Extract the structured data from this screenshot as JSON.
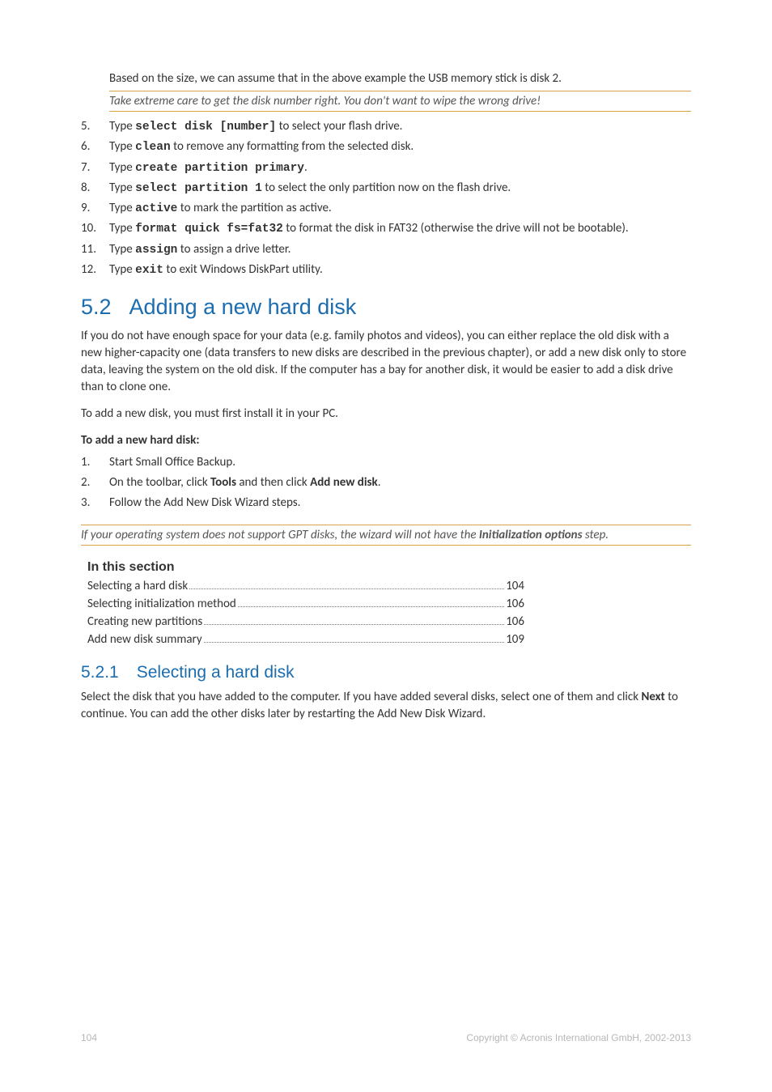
{
  "intro_line": "Based on the size, we can assume that in the above example the USB memory stick is disk 2.",
  "warning_text": "Take extreme care to get the disk number right. You don't want to wipe the wrong drive!",
  "steps_first": [
    {
      "n": "5.",
      "pre": "Type ",
      "cmd": "select disk [number]",
      "post": " to select your flash drive."
    },
    {
      "n": "6.",
      "pre": "Type ",
      "cmd": "clean",
      "post": " to remove any formatting from the selected disk."
    },
    {
      "n": "7.",
      "pre": "Type ",
      "cmd": "create partition primary",
      "post": "."
    },
    {
      "n": "8.",
      "pre": "Type ",
      "cmd": "select partition 1",
      "post": " to select the only partition now on the flash drive."
    },
    {
      "n": "9.",
      "pre": "Type ",
      "cmd": "active",
      "post": " to mark the partition as active."
    },
    {
      "n": "10.",
      "pre": "Type ",
      "cmd": "format quick fs=fat32",
      "post": " to format the disk in FAT32 (otherwise the drive will not be bootable)."
    },
    {
      "n": "11.",
      "pre": "Type ",
      "cmd": "assign",
      "post": " to assign a drive letter."
    },
    {
      "n": "12.",
      "pre": "Type ",
      "cmd": "exit",
      "post": " to exit Windows DiskPart utility."
    }
  ],
  "h1_num": "5.2",
  "h1_text": "Adding a new hard disk",
  "para1": "If you do not have enough space for your data (e.g. family photos and videos), you can either replace the old disk with a new higher-capacity one (data transfers to new disks are described in the previous chapter), or add a new disk only to store data, leaving the system on the old disk. If the computer has a bay for another disk, it would be easier to add a disk drive than to clone one.",
  "para2": "To add a new disk, you must first install it in your PC.",
  "subhead": "To add a new hard disk:",
  "steps_second": [
    {
      "n": "1.",
      "html": "Start Small Office Backup."
    },
    {
      "n": "2.",
      "html": "On the toolbar, click <b>Tools</b> and then click <b>Add new disk</b>."
    },
    {
      "n": "3.",
      "html": "Follow the Add New Disk Wizard steps."
    }
  ],
  "wizard_note_pre": "If your operating system does not support GPT disks, the wizard will not have the ",
  "wizard_note_strong": "Initialization options",
  "wizard_note_post": " step.",
  "section_title": "In this section",
  "toc": [
    {
      "label": "Selecting a hard disk ",
      "page": "104"
    },
    {
      "label": "Selecting initialization method ",
      "page": "106"
    },
    {
      "label": "Creating new partitions",
      "page": "106"
    },
    {
      "label": "Add new disk summary",
      "page": "109"
    }
  ],
  "h2_num": "5.2.1",
  "h2_text": "Selecting a hard disk",
  "para3_pre": "Select the disk that you have added to the computer. If you have added several disks, select one of them and click ",
  "para3_bold": "Next",
  "para3_post": " to continue. You can add the other disks later by restarting the Add New Disk Wizard.",
  "footer_page": "104",
  "footer_copy": "Copyright © Acronis International GmbH, 2002-2013"
}
